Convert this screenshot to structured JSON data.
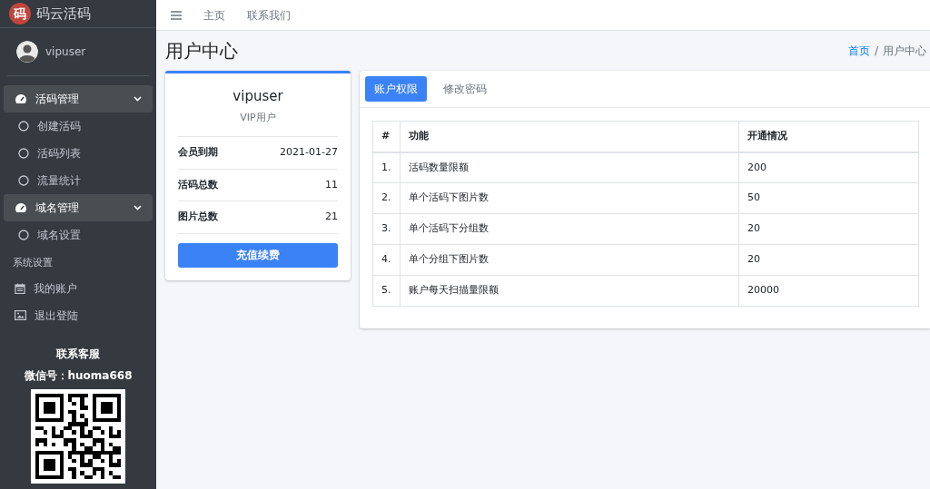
{
  "brand": {
    "logo": "码",
    "name": "码云活码"
  },
  "user": {
    "name": "vipuser"
  },
  "sidebar": [
    {
      "kind": "group",
      "label": "活码管理",
      "expanded": true,
      "selected": true,
      "children": [
        {
          "kind": "sub",
          "label": "创建活码"
        },
        {
          "kind": "sub",
          "label": "活码列表"
        },
        {
          "kind": "sub",
          "label": "流量统计"
        }
      ]
    },
    {
      "kind": "group",
      "label": "域名管理",
      "expanded": true,
      "selected": true,
      "children": [
        {
          "kind": "sub",
          "label": "域名设置"
        }
      ]
    },
    {
      "kind": "header",
      "label": "系统设置"
    },
    {
      "kind": "calendar",
      "label": "我的账户"
    },
    {
      "kind": "gallery",
      "label": "退出登陆"
    }
  ],
  "contact": {
    "title": "联系客服",
    "wechat": "微信号：huoma668"
  },
  "topnav": [
    "主页",
    "联系我们"
  ],
  "page_title": "用户中心",
  "breadcrumb_separator": "/",
  "breadcrumb": [
    {
      "label": "首页",
      "selected": false
    },
    {
      "label": "用户中心",
      "selected": true
    }
  ],
  "profile": {
    "name": "vipuser",
    "role": "VIP用户",
    "stats": [
      {
        "label": "会员到期",
        "value": "2021-01-27"
      },
      {
        "label": "活码总数",
        "value": "11"
      },
      {
        "label": "图片总数",
        "value": "21"
      }
    ],
    "button": "充值续费"
  },
  "tabs": [
    {
      "label": "账户权限",
      "selected": true
    },
    {
      "label": "修改密码",
      "selected": false
    }
  ],
  "table": {
    "columns": [
      "#",
      "功能",
      "开通情况"
    ],
    "rows": [
      [
        "1.",
        "活码数量限额",
        "200"
      ],
      [
        "2.",
        "单个活码下图片数",
        "50"
      ],
      [
        "3.",
        "单个活码下分组数",
        "20"
      ],
      [
        "4.",
        "单个分组下图片数",
        "20"
      ],
      [
        "5.",
        "账户每天扫描量限额",
        "20000"
      ]
    ]
  }
}
